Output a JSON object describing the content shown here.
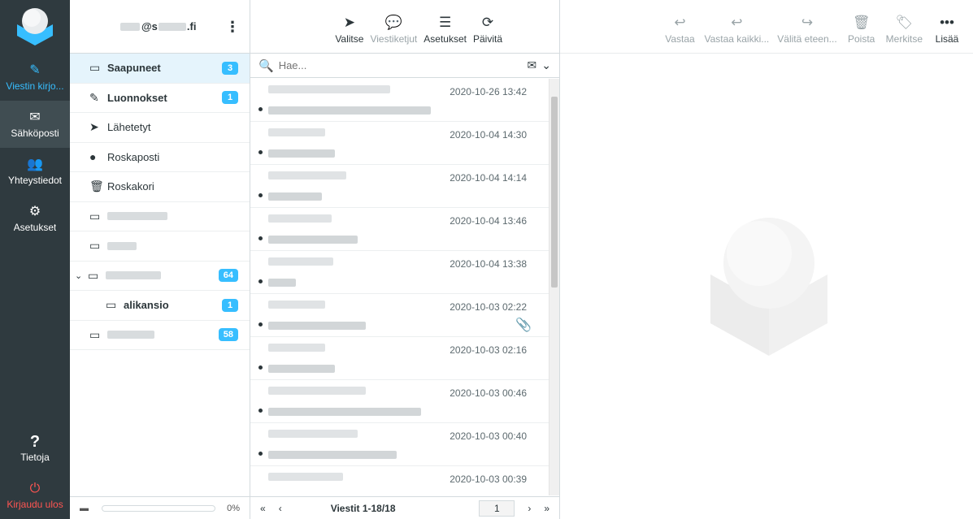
{
  "nav": {
    "compose": "Viestin kirjo...",
    "mail": "Sähköposti",
    "contacts": "Yhteystiedot",
    "settings": "Asetukset",
    "about": "Tietoja",
    "logout": "Kirjaudu ulos"
  },
  "account": {
    "email_suffix": "@s",
    "domain": ".fi"
  },
  "folders": [
    {
      "name": "Saapuneet",
      "badge": "3"
    },
    {
      "name": "Luonnokset",
      "badge": "1"
    },
    {
      "name": "Lähetetyt"
    },
    {
      "name": "Roskaposti"
    },
    {
      "name": "Roskakori"
    },
    {
      "name": ""
    },
    {
      "name": ""
    },
    {
      "name": "",
      "badge": "64"
    },
    {
      "name": "alikansio",
      "badge": "1"
    },
    {
      "name": "",
      "badge": "58"
    }
  ],
  "quota": {
    "percent": "0%"
  },
  "list_toolbar": {
    "select": "Valitse",
    "threads": "Viestiketjut",
    "options": "Asetukset",
    "refresh": "Päivitä"
  },
  "search": {
    "placeholder": "Hae..."
  },
  "messages": [
    {
      "date": "2020-10-26 13:42"
    },
    {
      "date": "2020-10-04 14:30"
    },
    {
      "date": "2020-10-04 14:14"
    },
    {
      "date": "2020-10-04 13:46"
    },
    {
      "date": "2020-10-04 13:38"
    },
    {
      "date": "2020-10-03 02:22"
    },
    {
      "date": "2020-10-03 02:16"
    },
    {
      "date": "2020-10-03 00:46"
    },
    {
      "date": "2020-10-03 00:40"
    },
    {
      "date": "2020-10-03 00:39"
    }
  ],
  "pagination": {
    "count": "Viestit 1-18/18",
    "page": "1"
  },
  "preview_toolbar": {
    "reply": "Vastaa",
    "reply_all": "Vastaa kaikki...",
    "forward": "Välitä eteen...",
    "delete": "Poista",
    "mark": "Merkitse",
    "more": "Lisää"
  },
  "colors": {
    "accent": "#37beff",
    "nav_bg": "#2f3a3f",
    "logout": "#ff5552"
  }
}
